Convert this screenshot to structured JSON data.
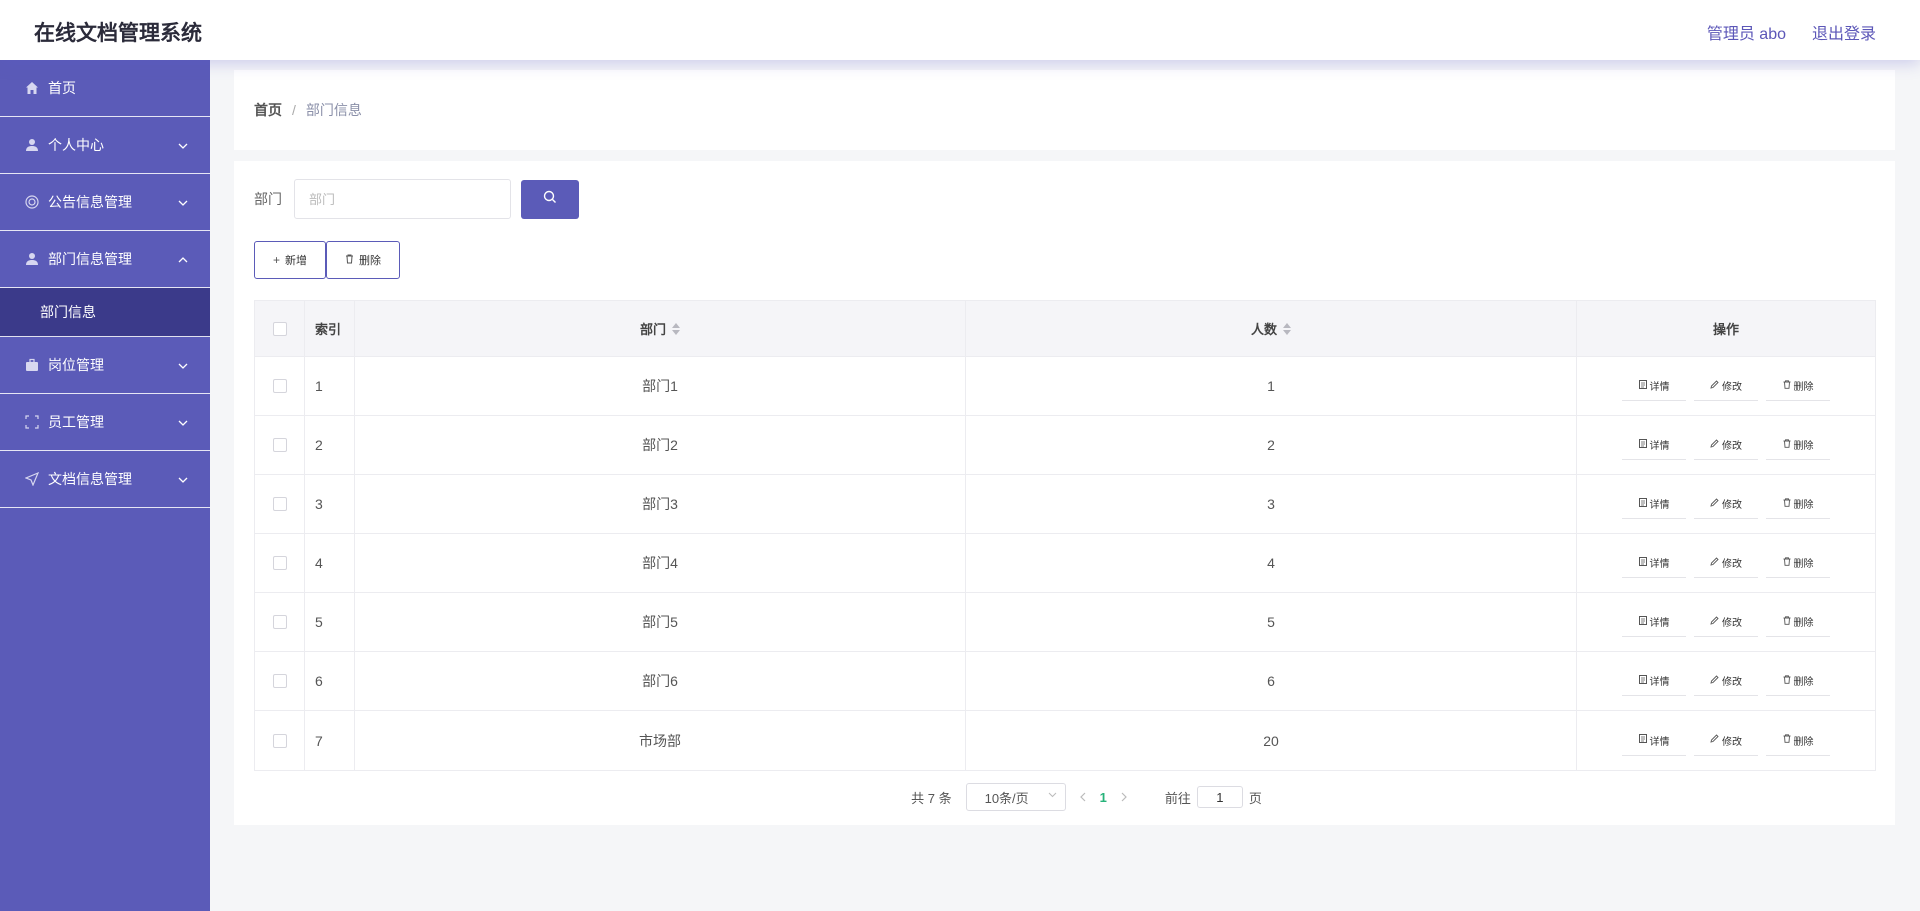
{
  "header": {
    "app_title": "在线文档管理系统",
    "user_label": "管理员 abo",
    "logout_label": "退出登录"
  },
  "sidebar": {
    "items": [
      {
        "label": "首页",
        "icon": "home-icon"
      },
      {
        "label": "个人中心",
        "icon": "user-icon"
      },
      {
        "label": "公告信息管理",
        "icon": "announcement-icon"
      },
      {
        "label": "部门信息管理",
        "icon": "user-icon"
      },
      {
        "label": "岗位管理",
        "icon": "briefcase-icon"
      },
      {
        "label": "员工管理",
        "icon": "scan-icon"
      },
      {
        "label": "文档信息管理",
        "icon": "send-icon"
      }
    ],
    "sub_item": "部门信息"
  },
  "breadcrumb": {
    "home": "首页",
    "separator": "/",
    "current": "部门信息"
  },
  "search": {
    "label": "部门",
    "placeholder": "部门"
  },
  "actions": {
    "add_label": "新增",
    "delete_label": "删除"
  },
  "table": {
    "columns": [
      "索引",
      "部门",
      "人数",
      "操作"
    ],
    "rows": [
      {
        "index": "1",
        "dept": "部门1",
        "count": "1"
      },
      {
        "index": "2",
        "dept": "部门2",
        "count": "2"
      },
      {
        "index": "3",
        "dept": "部门3",
        "count": "3"
      },
      {
        "index": "4",
        "dept": "部门4",
        "count": "4"
      },
      {
        "index": "5",
        "dept": "部门5",
        "count": "5"
      },
      {
        "index": "6",
        "dept": "部门6",
        "count": "6"
      },
      {
        "index": "7",
        "dept": "市场部",
        "count": "20"
      }
    ],
    "op_labels": {
      "detail": "详情",
      "edit": "修改",
      "delete": "删除"
    }
  },
  "pagination": {
    "total_text": "共 7 条",
    "page_size": "10条/页",
    "current_page": "1",
    "goto_label": "前往",
    "goto_value": "1",
    "page_suffix": "页"
  },
  "colors": {
    "primary": "#5b5bb8",
    "sidebar_active": "#3b3a8a",
    "page_active": "#27b37a"
  }
}
